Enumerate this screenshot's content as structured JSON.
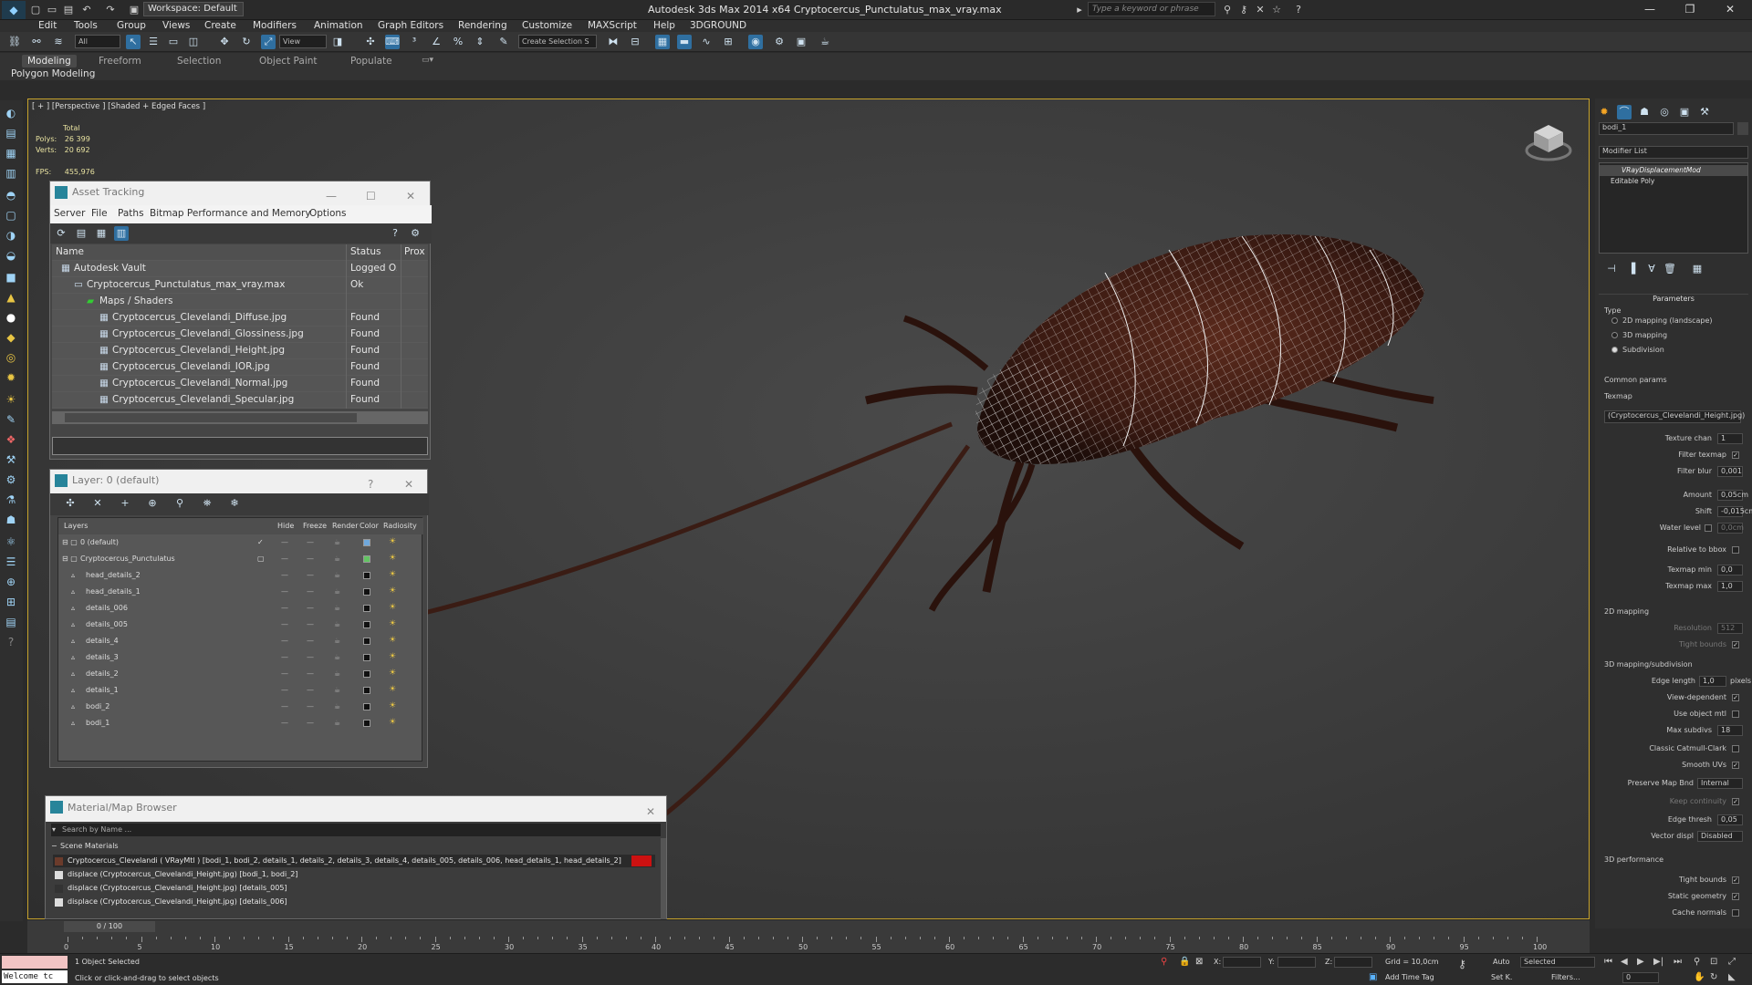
{
  "window": {
    "title": "Autodesk 3ds Max  2014 x64     Cryptocercus_Punctulatus_max_vray.max",
    "workspace": "Workspace: Default",
    "search_placeholder": "Type a keyword or phrase"
  },
  "menu": [
    "Edit",
    "Tools",
    "Group",
    "Views",
    "Create",
    "Modifiers",
    "Animation",
    "Graph Editors",
    "Rendering",
    "Customize",
    "MAXScript",
    "Help",
    "3DGROUND"
  ],
  "toolbar": {
    "selection_filter": "All",
    "ref_coord": "View",
    "named_selection": "Create Selection S"
  },
  "ribbon": {
    "tabs": [
      "Modeling",
      "Freeform",
      "Selection",
      "Object Paint",
      "Populate"
    ],
    "active_tab": "Modeling",
    "sub_label": "Polygon Modeling"
  },
  "viewport": {
    "label": "[ + ] [Perspective ] [Shaded + Edged Faces ]",
    "stats_total": "Total",
    "polys_label": "Polys:",
    "polys_value": "26 399",
    "verts_label": "Verts:",
    "verts_value": "20 692",
    "fps_label": "FPS:",
    "fps_value": "455,976"
  },
  "asset_tracking": {
    "title": "Asset Tracking",
    "menu": [
      "Server",
      "File",
      "Paths",
      "Bitmap Performance and Memory",
      "Options"
    ],
    "columns": [
      "Name",
      "Status",
      "Prox"
    ],
    "rows": [
      {
        "name": "Autodesk Vault",
        "status": "Logged O...",
        "indent": 1
      },
      {
        "name": "Cryptocercus_Punctulatus_max_vray.max",
        "status": "Ok",
        "indent": 2
      },
      {
        "name": "Maps / Shaders",
        "status": "",
        "indent": 3
      },
      {
        "name": "Cryptocercus_Clevelandi_Diffuse.jpg",
        "status": "Found",
        "indent": 4
      },
      {
        "name": "Cryptocercus_Clevelandi_Glossiness.jpg",
        "status": "Found",
        "indent": 4
      },
      {
        "name": "Cryptocercus_Clevelandi_Height.jpg",
        "status": "Found",
        "indent": 4
      },
      {
        "name": "Cryptocercus_Clevelandi_IOR.jpg",
        "status": "Found",
        "indent": 4
      },
      {
        "name": "Cryptocercus_Clevelandi_Normal.jpg",
        "status": "Found",
        "indent": 4
      },
      {
        "name": "Cryptocercus_Clevelandi_Specular.jpg",
        "status": "Found",
        "indent": 4
      }
    ]
  },
  "layer_panel": {
    "title": "Layer: 0 (default)",
    "columns": [
      "Layers",
      "Hide",
      "Freeze",
      "Render",
      "Color",
      "Radiosity"
    ],
    "rows": [
      {
        "name": "0 (default)",
        "color": "#6fa8dc",
        "level": 1
      },
      {
        "name": "Cryptocercus_Punctulatus",
        "color": "#63c463",
        "level": 1
      },
      {
        "name": "head_details_2",
        "color": "#111111",
        "level": 2
      },
      {
        "name": "head_details_1",
        "color": "#111111",
        "level": 2
      },
      {
        "name": "details_006",
        "color": "#111111",
        "level": 2
      },
      {
        "name": "details_005",
        "color": "#111111",
        "level": 2
      },
      {
        "name": "details_4",
        "color": "#111111",
        "level": 2
      },
      {
        "name": "details_3",
        "color": "#111111",
        "level": 2
      },
      {
        "name": "details_2",
        "color": "#111111",
        "level": 2
      },
      {
        "name": "details_1",
        "color": "#111111",
        "level": 2
      },
      {
        "name": "bodi_2",
        "color": "#111111",
        "level": 2
      },
      {
        "name": "bodi_1",
        "color": "#111111",
        "level": 2
      }
    ]
  },
  "material_browser": {
    "title": "Material/Map Browser",
    "search_placeholder": "Search by Name ...",
    "section": "Scene Materials",
    "items": [
      "Cryptocercus_Clevelandi ( VRayMtl ) [bodi_1, bodi_2, details_1, details_2, details_3, details_4, details_005, details_006, head_details_1, head_details_2]",
      "displace (Cryptocercus_Clevelandi_Height.jpg) [bodi_1, bodi_2]",
      "displace (Cryptocercus_Clevelandi_Height.jpg) [details_005]",
      "displace (Cryptocercus_Clevelandi_Height.jpg) [details_006]"
    ]
  },
  "command_panel": {
    "object_name": "bodi_1",
    "modifier_list": "Modifier List",
    "stack": [
      "VRayDisplacementMod",
      "Editable Poly"
    ],
    "parameters_title": "Parameters",
    "type_label": "Type",
    "type_options": [
      "2D mapping (landscape)",
      "3D mapping",
      "Subdivision"
    ],
    "type_selected": "Subdivision",
    "common_params": "Common params",
    "texmap_label": "Texmap",
    "texmap_value": "(Cryptocercus_Clevelandi_Height.jpg)",
    "texture_chan_label": "Texture chan",
    "texture_chan_value": "1",
    "filter_texmap": "Filter texmap",
    "filter_blur_label": "Filter blur",
    "filter_blur_value": "0,001",
    "amount_label": "Amount",
    "amount_value": "0,05cm",
    "shift_label": "Shift",
    "shift_value": "-0,015cm",
    "water_level_label": "Water level",
    "water_level_value": "0,0cm",
    "relative_bbox": "Relative to bbox",
    "texmap_min_label": "Texmap min",
    "texmap_min_value": "0,0",
    "texmap_max_label": "Texmap max",
    "texmap_max_value": "1,0",
    "mapping_2d": "2D mapping",
    "resolution_label": "Resolution",
    "resolution_value": "512",
    "tight_bounds": "Tight bounds",
    "mapping_3d": "3D mapping/subdivision",
    "edge_length_label": "Edge length",
    "edge_length_value": "1,0",
    "pixels": "pixels",
    "view_dependent": "View-dependent",
    "use_object_mtl": "Use object mtl",
    "max_subdivs_label": "Max subdivs",
    "max_subdivs_value": "18",
    "classic_catmull": "Classic Catmull-Clark",
    "smooth_uvs": "Smooth UVs",
    "preserve_map_label": "Preserve Map Bnd",
    "preserve_map_value": "Internal",
    "keep_continuity": "Keep continuity",
    "edge_thresh_label": "Edge thresh",
    "edge_thresh_value": "0,05",
    "vector_displ_label": "Vector displ",
    "vector_displ_value": "Disabled",
    "performance_3d": "3D performance",
    "tight_bounds_2": "Tight bounds",
    "static_geometry": "Static geometry",
    "cache_normals": "Cache normals"
  },
  "timeline": {
    "frame": "0 / 100",
    "ticks": [
      "0",
      "5",
      "10",
      "15",
      "20",
      "25",
      "30",
      "35",
      "40",
      "45",
      "50",
      "55",
      "60",
      "65",
      "70",
      "75",
      "80",
      "85",
      "90",
      "95",
      "100"
    ]
  },
  "status": {
    "selected": "1 Object Selected",
    "hint": "Click or click-and-drag to select objects",
    "welcome": "Welcome tc",
    "x_label": "X:",
    "y_label": "Y:",
    "z_label": "Z:",
    "grid": "Grid = 10,0cm",
    "add_time_tag": "Add Time Tag",
    "auto": "Auto",
    "set_key": "Set K.",
    "selected_mode": "Selected",
    "filters": "Filters...",
    "frame_value": "0"
  },
  "colors": {
    "accent_blue": "#27849a",
    "viewport_border": "#c7a32c",
    "stats_text": "#e8e2a0"
  }
}
